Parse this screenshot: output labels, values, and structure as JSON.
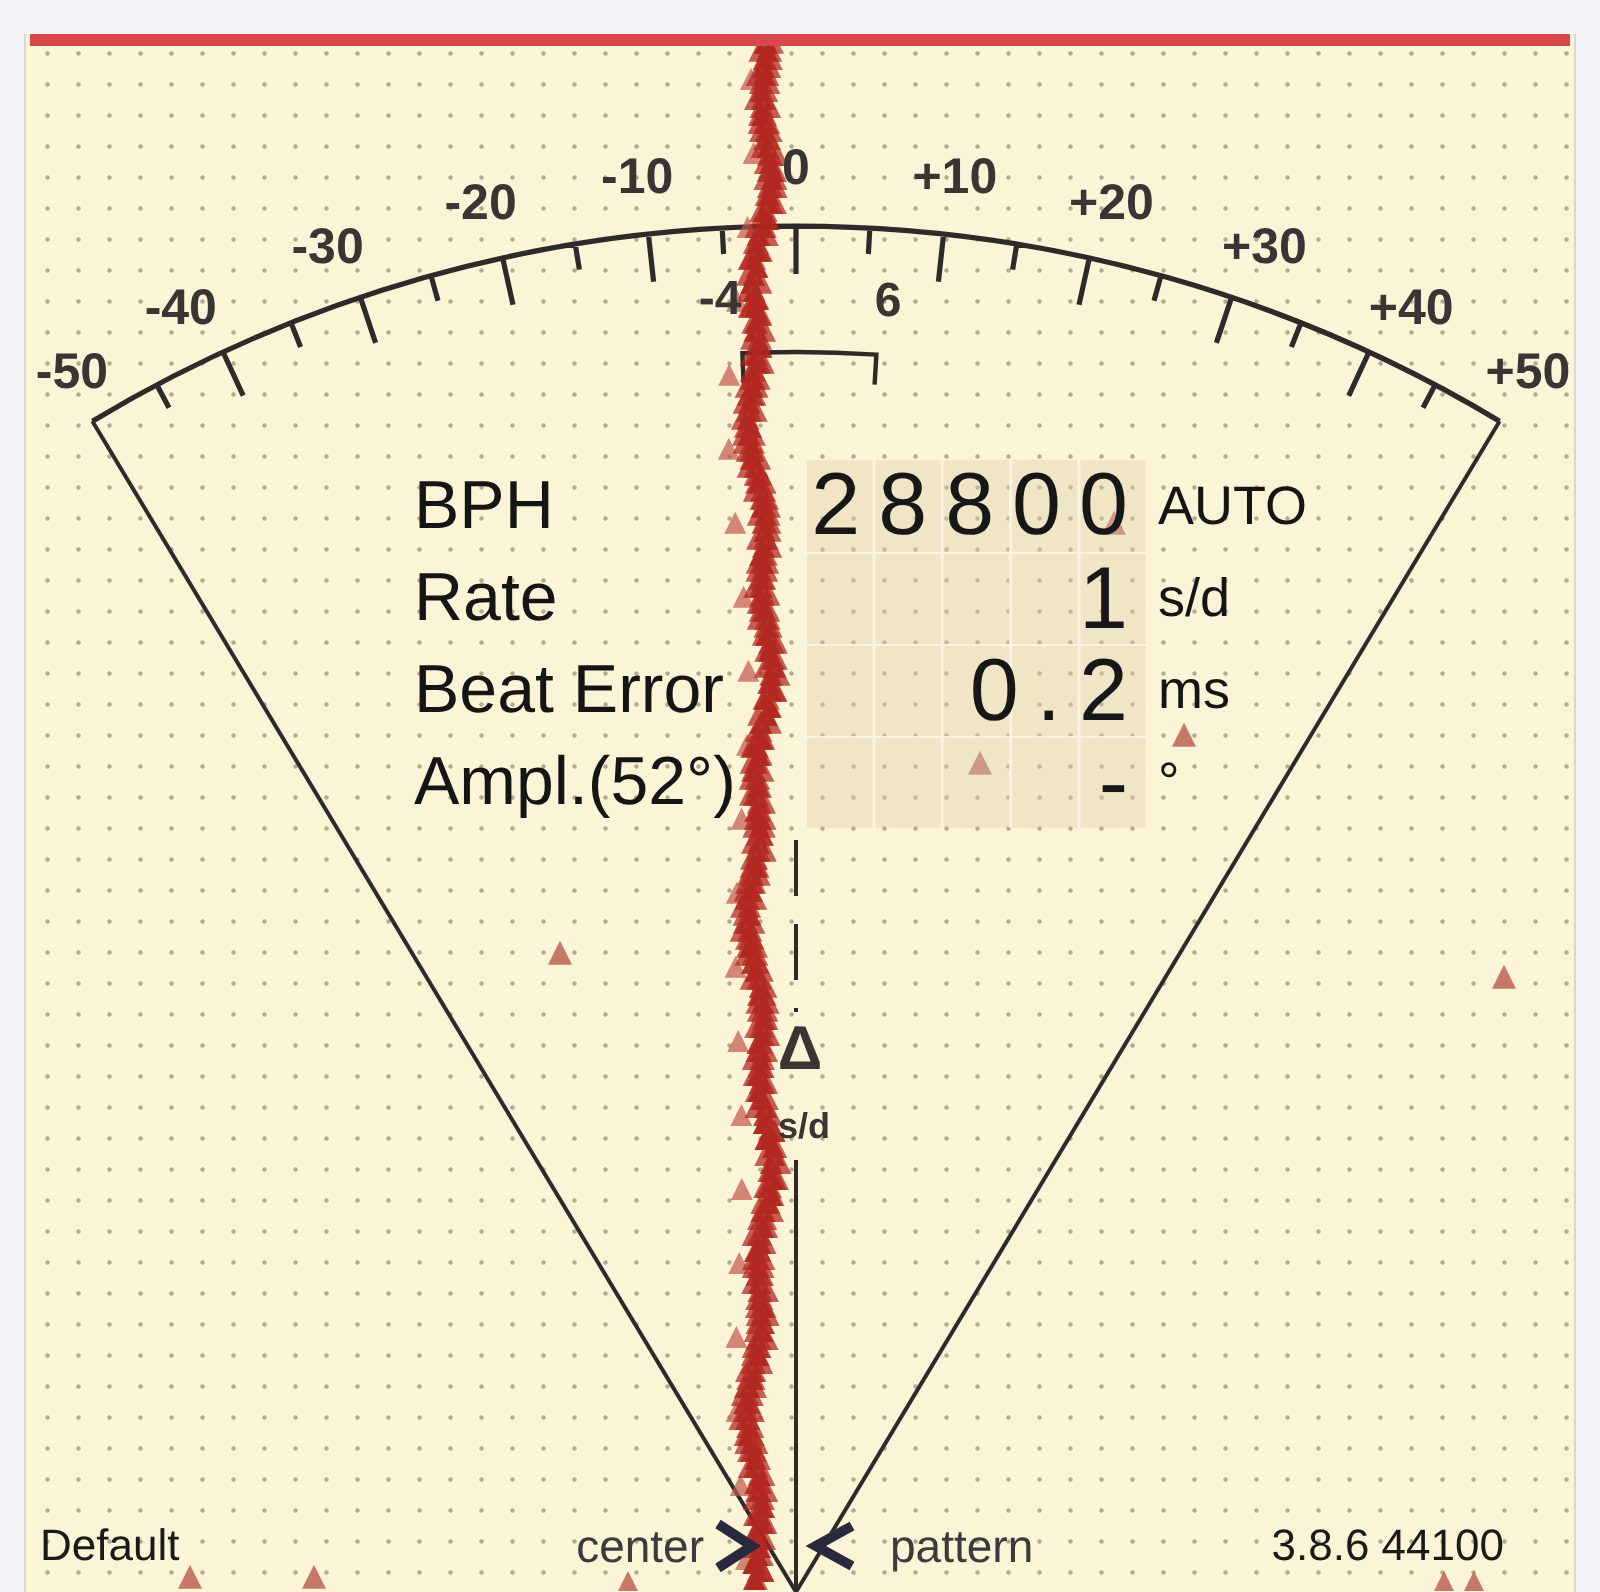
{
  "scale": {
    "labels": [
      "-50",
      "-40",
      "-30",
      "-20",
      "-10",
      "0",
      "+10",
      "+20",
      "+30",
      "+40",
      "+50"
    ],
    "range_labels": [
      "-4",
      "6"
    ]
  },
  "readings": [
    {
      "label": "BPH",
      "value": "28800",
      "unit": "AUTO"
    },
    {
      "label": "Rate",
      "value": "1",
      "unit": "s/d"
    },
    {
      "label": "Beat Error",
      "value": "0.2",
      "unit": "ms"
    },
    {
      "label": "Ampl.(52°)",
      "value": "-",
      "unit": "°"
    }
  ],
  "center_marker": {
    "symbol": "Δ",
    "unit": "s/d"
  },
  "footer": {
    "preset": "Default",
    "center_button": "center",
    "pattern_button": "pattern",
    "version": "3.8.6 44100"
  }
}
